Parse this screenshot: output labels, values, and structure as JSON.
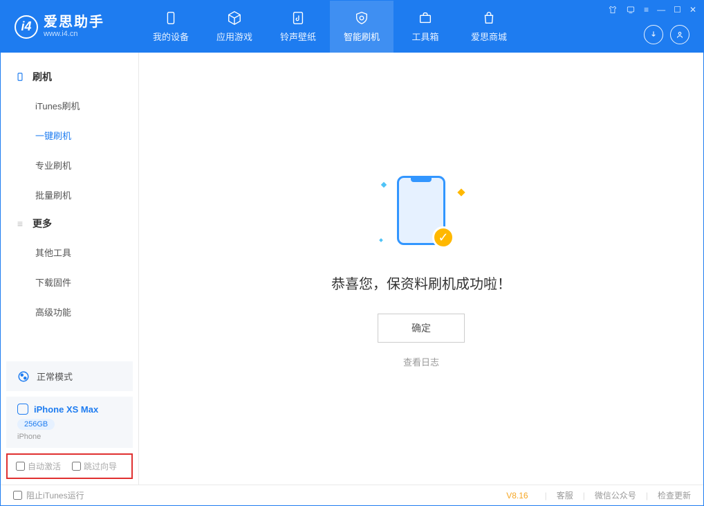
{
  "app": {
    "name": "爱思助手",
    "url": "www.i4.cn"
  },
  "tabs": [
    {
      "label": "我的设备"
    },
    {
      "label": "应用游戏"
    },
    {
      "label": "铃声壁纸"
    },
    {
      "label": "智能刷机"
    },
    {
      "label": "工具箱"
    },
    {
      "label": "爱思商城"
    }
  ],
  "sidebar": {
    "section1": {
      "title": "刷机",
      "items": [
        "iTunes刷机",
        "一键刷机",
        "专业刷机",
        "批量刷机"
      ]
    },
    "section2": {
      "title": "更多",
      "items": [
        "其他工具",
        "下载固件",
        "高级功能"
      ]
    },
    "mode": "正常模式",
    "device": {
      "name": "iPhone XS Max",
      "capacity": "256GB",
      "type": "iPhone"
    },
    "checkboxes": {
      "autoActivate": "自动激活",
      "skipGuide": "跳过向导"
    }
  },
  "main": {
    "successText": "恭喜您，保资料刷机成功啦！",
    "okBtn": "确定",
    "logLink": "查看日志"
  },
  "footer": {
    "blockItunes": "阻止iTunes运行",
    "version": "V8.16",
    "links": [
      "客服",
      "微信公众号",
      "检查更新"
    ]
  }
}
